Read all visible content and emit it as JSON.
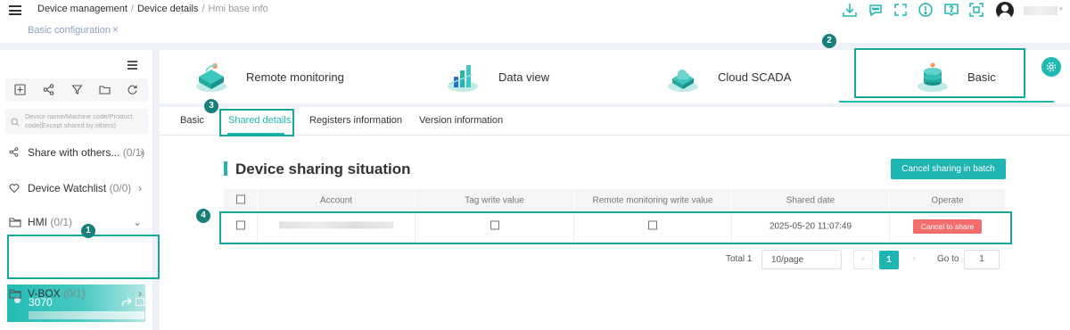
{
  "breadcrumb": [
    "Device management",
    "Device details",
    "Hmi base info"
  ],
  "breadcrumb_sep": "/",
  "open_tab": {
    "label": "Basic configuration",
    "close": "×"
  },
  "header_icons": [
    "download-icon",
    "chat-icon",
    "fullscreen-icon",
    "alert-icon",
    "help-icon",
    "scan-icon"
  ],
  "sidebar": {
    "search_placeholder": "Device name/Machine code/Product code(Except shared by others)",
    "tools": [
      "add-icon",
      "share-icon",
      "filter-icon",
      "folder-icon",
      "refresh-icon"
    ],
    "items": [
      {
        "label": "Share with others...",
        "count": "(0/1)",
        "chevron": "›"
      },
      {
        "label": "Device Watchlist",
        "count": "(0/0)",
        "chevron": "›"
      },
      {
        "label": "HMI",
        "count": "(0/1)",
        "chevron": "⌄"
      },
      {
        "label": "V-BOX",
        "count": "(0/1)",
        "chevron": "›"
      }
    ],
    "selected_device": "3070"
  },
  "features": [
    {
      "label": "Remote monitoring"
    },
    {
      "label": "Data view"
    },
    {
      "label": "Cloud SCADA"
    },
    {
      "label": "Basic"
    }
  ],
  "subtabs": [
    "Basic",
    "Shared details",
    "Registers information",
    "Version information"
  ],
  "section_title": "Device sharing situation",
  "batch_button": "Cancel sharing in batch",
  "table": {
    "headers": [
      "Account",
      "Tag write value",
      "Remote monitoring write value",
      "Shared date",
      "Operate"
    ],
    "rows": [
      {
        "shared_date": "2025-05-20 11:07:49",
        "operate": "Cancel to share"
      }
    ]
  },
  "pagination": {
    "total": "Total 1",
    "page_size": "10/page",
    "current": "1",
    "prev": "‹",
    "next": "›",
    "goto_label": "Go to",
    "goto_value": "1"
  },
  "annotations": [
    "1",
    "2",
    "3",
    "4"
  ],
  "accent_color": "#1fb5b3",
  "danger_color": "#f36d6d"
}
